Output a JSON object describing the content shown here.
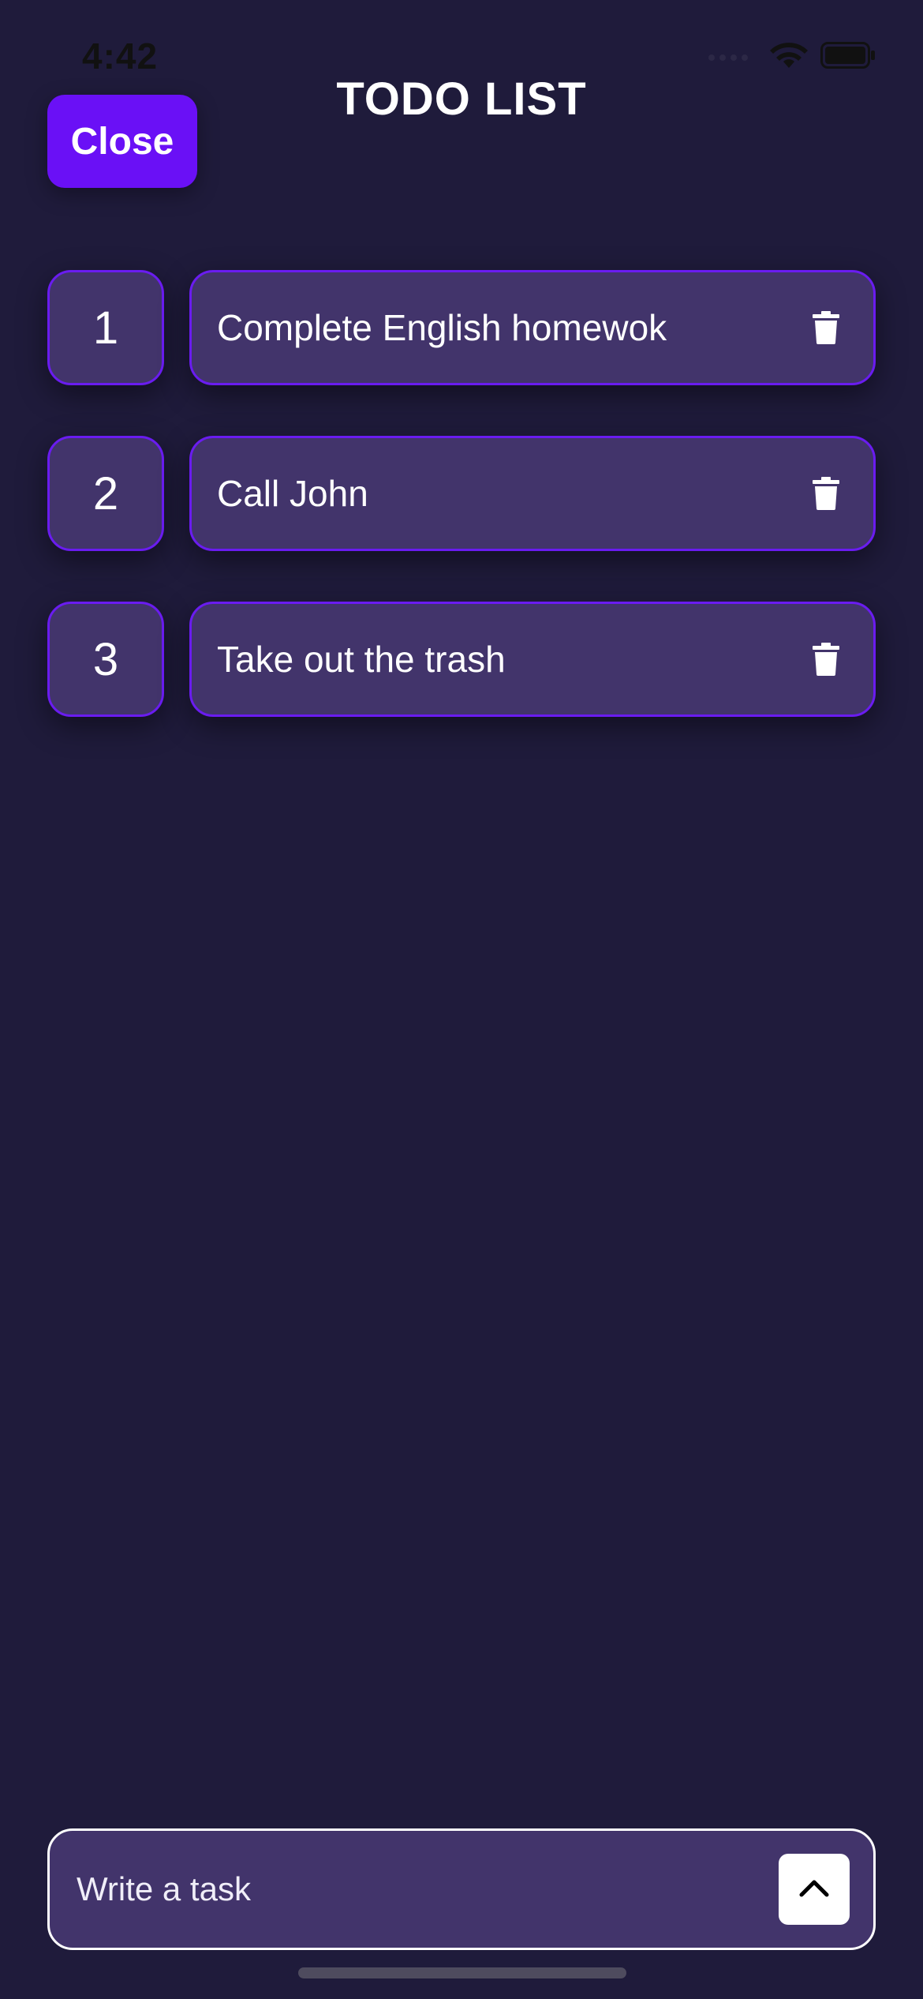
{
  "status_bar": {
    "time": "4:42"
  },
  "header": {
    "close_label": "Close",
    "title": "TODO LIST"
  },
  "tasks": [
    {
      "number": "1",
      "text": "Complete English homewok"
    },
    {
      "number": "2",
      "text": "Call John"
    },
    {
      "number": "3",
      "text": "Take out the trash"
    }
  ],
  "input": {
    "placeholder": "Write a task",
    "value": ""
  },
  "icons": {
    "delete": "trash-icon",
    "submit": "chevron-up-icon",
    "wifi": "wifi-icon",
    "battery": "battery-icon"
  },
  "colors": {
    "background": "#1f1b3b",
    "accent": "#6a10f6",
    "card": "#42346b",
    "card_border": "#6a1cf0"
  }
}
